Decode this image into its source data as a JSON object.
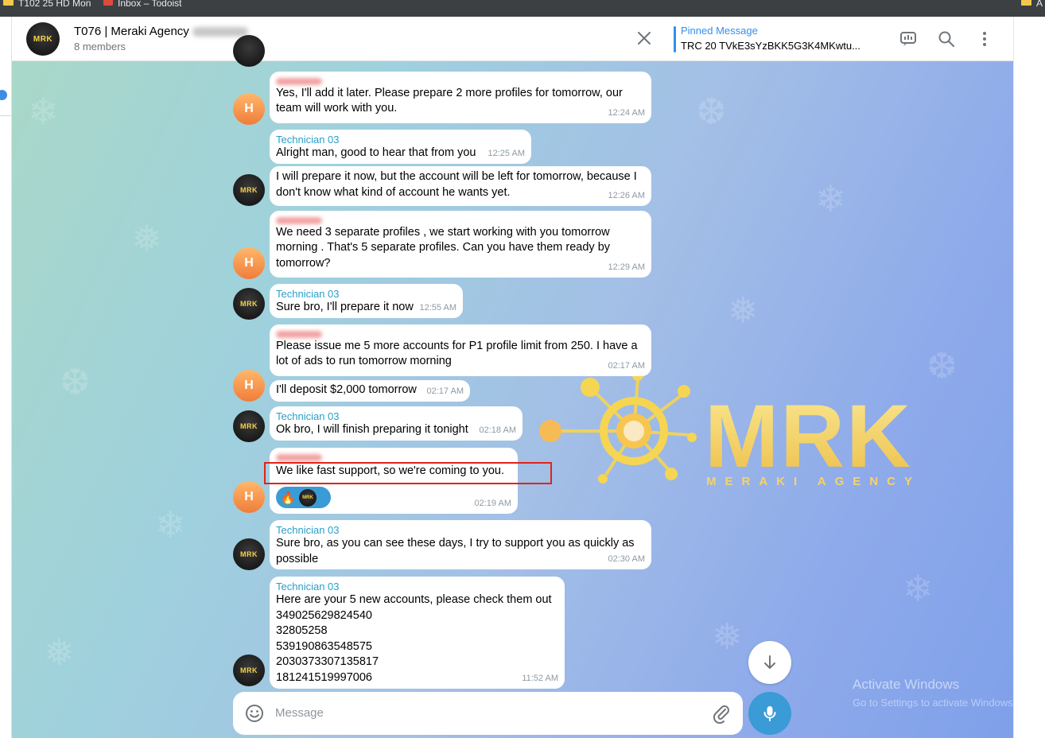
{
  "browser": {
    "bookmarks": [
      {
        "label": "T102 25 HD Mon",
        "icon": "folder-icon"
      },
      {
        "label": "Inbox – Todoist",
        "icon": "todoist-icon"
      },
      {
        "label": "A",
        "icon": "folder-icon"
      }
    ]
  },
  "header": {
    "avatar_text": "MRK",
    "title": "T076 | Meraki Agency",
    "members": "8 members",
    "pinned_label": "Pinned Message",
    "pinned_text": "TRC 20 TVkE3sYzBKK5G3K4MKwtu..."
  },
  "messages": [
    {
      "sender": "",
      "text": "Yes, I'll add it later. Please prepare 2 more profiles for tomorrow, our team will work with you.",
      "time": "12:24 AM",
      "avatar": "H"
    },
    {
      "sender": "Technician 03",
      "text": "Alright man, good to hear that from you",
      "time": "12:25 AM",
      "avatar": ""
    },
    {
      "sender": "",
      "text": "I will prepare it now, but the account will be left for tomorrow, because I don't know what kind of account he wants yet.",
      "time": "12:26 AM",
      "avatar": "MRK"
    },
    {
      "sender": "",
      "text": "We need 3 separate profiles , we start working with you tomorrow morning . That's 5 separate profiles. Can you have them ready by tomorrow?",
      "time": "12:29 AM",
      "avatar": "H"
    },
    {
      "sender": "Technician 03",
      "text": "Sure bro, I'll prepare it now",
      "time": "12:55 AM",
      "avatar": "MRK"
    },
    {
      "sender": "",
      "text": "Please issue me 5 more accounts for P1 profile limit from 250. I have a lot of ads to run tomorrow morning",
      "time": "02:17 AM",
      "avatar": ""
    },
    {
      "sender": "",
      "text": "I'll deposit $2,000 tomorrow",
      "time": "02:17 AM",
      "avatar": "H"
    },
    {
      "sender": "Technician 03",
      "text": "Ok bro, I will finish preparing it tonight",
      "time": "02:18 AM",
      "avatar": "MRK"
    },
    {
      "sender": "",
      "text": "We like fast support, so we're coming to you.",
      "time": "02:19 AM",
      "avatar": "H",
      "reactions": [
        "🔥",
        "MRK"
      ]
    },
    {
      "sender": "Technician 03",
      "text": "Sure bro, as you can see these days, I try to support you as quickly as possible",
      "time": "02:30 AM",
      "avatar": "MRK"
    },
    {
      "sender": "Technician 03",
      "text": "Here are your 5 new accounts, please check them out",
      "lines": [
        "349025629824540",
        "32805258",
        "539190863548575",
        "2030373307135817",
        "181241519997006"
      ],
      "time": "11:52 AM",
      "avatar": "MRK"
    }
  ],
  "watermark": {
    "text": "MRK",
    "subtitle": "MERAKI AGENCY"
  },
  "composer": {
    "placeholder": "Message"
  },
  "system_watermark": {
    "line1": "Activate Windows",
    "line2": "Go to Settings to activate Windows."
  },
  "colors": {
    "accent": "#3390ec",
    "sender": "#2a9fc7",
    "mic": "#3a9bd6",
    "highlight": "#e2231a",
    "avatar_h": "#f07d3a"
  }
}
